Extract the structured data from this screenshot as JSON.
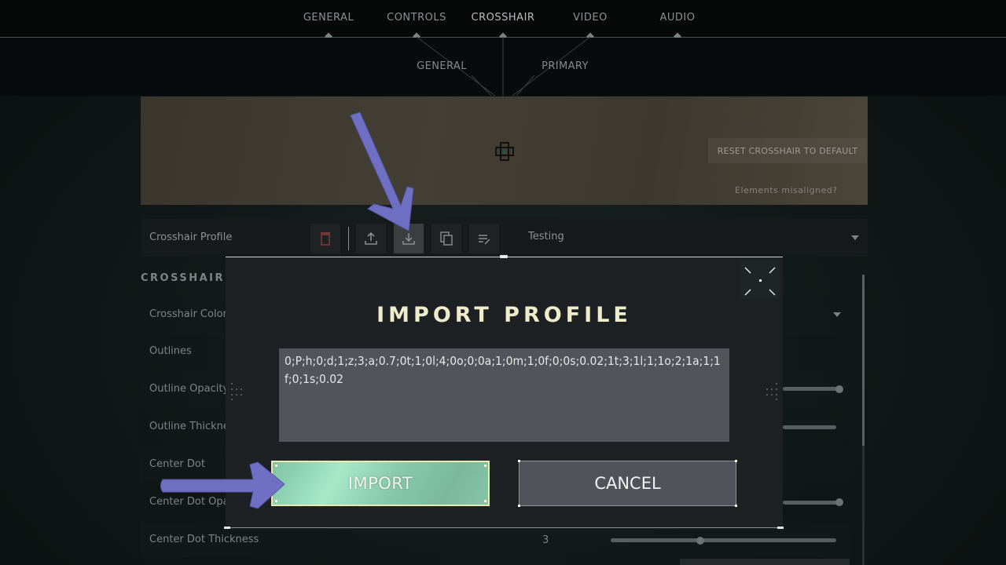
{
  "top_tabs": [
    {
      "label": "GENERAL",
      "active": false
    },
    {
      "label": "CONTROLS",
      "active": false
    },
    {
      "label": "CROSSHAIR",
      "active": true
    },
    {
      "label": "VIDEO",
      "active": false
    },
    {
      "label": "AUDIO",
      "active": false
    }
  ],
  "sub_tabs": [
    {
      "label": "GENERAL"
    },
    {
      "label": "PRIMARY"
    }
  ],
  "preview": {
    "reset_label": "RESET CROSSHAIR TO DEFAULT",
    "misaligned_label": "Elements misaligned?"
  },
  "profile": {
    "label": "Crosshair Profile",
    "toolbar": [
      {
        "icon": "trash-icon",
        "color": "#7a3a3a"
      },
      {
        "icon": "upload-icon"
      },
      {
        "icon": "download-icon",
        "selected": true
      },
      {
        "icon": "copy-icon"
      },
      {
        "icon": "edit-list-icon"
      }
    ],
    "selected": "Testing"
  },
  "section": {
    "title": "CROSSHAIR",
    "rows": [
      {
        "label": "Crosshair Color",
        "type": "dropdown"
      },
      {
        "label": "Outlines",
        "type": "toggle"
      },
      {
        "label": "Outline Opacity",
        "type": "slider",
        "value_fraction": 1.0
      },
      {
        "label": "Outline Thickness",
        "type": "slider",
        "value_fraction": 0.0
      },
      {
        "label": "Center Dot",
        "type": "toggle"
      },
      {
        "label": "Center Dot Opacity",
        "type": "slider",
        "value_fraction": 1.0
      },
      {
        "label": "Center Dot Thickness",
        "type": "slider",
        "value": "3",
        "value_fraction": 0.39
      }
    ]
  },
  "modal": {
    "title": "IMPORT PROFILE",
    "code": "0;P;h;0;d;1;z;3;a;0.7;0t;1;0l;4;0o;0;0a;1;0m;1;0f;0;0s;0.02;1t;3;1l;1;1o;2;1a;1;1f;0;1s;0.02",
    "import_label": "IMPORT",
    "cancel_label": "CANCEL"
  },
  "colors": {
    "accent_import": "#8fd0b2",
    "title_color": "#efeccb",
    "annotation_arrow": "#6f70c4"
  }
}
